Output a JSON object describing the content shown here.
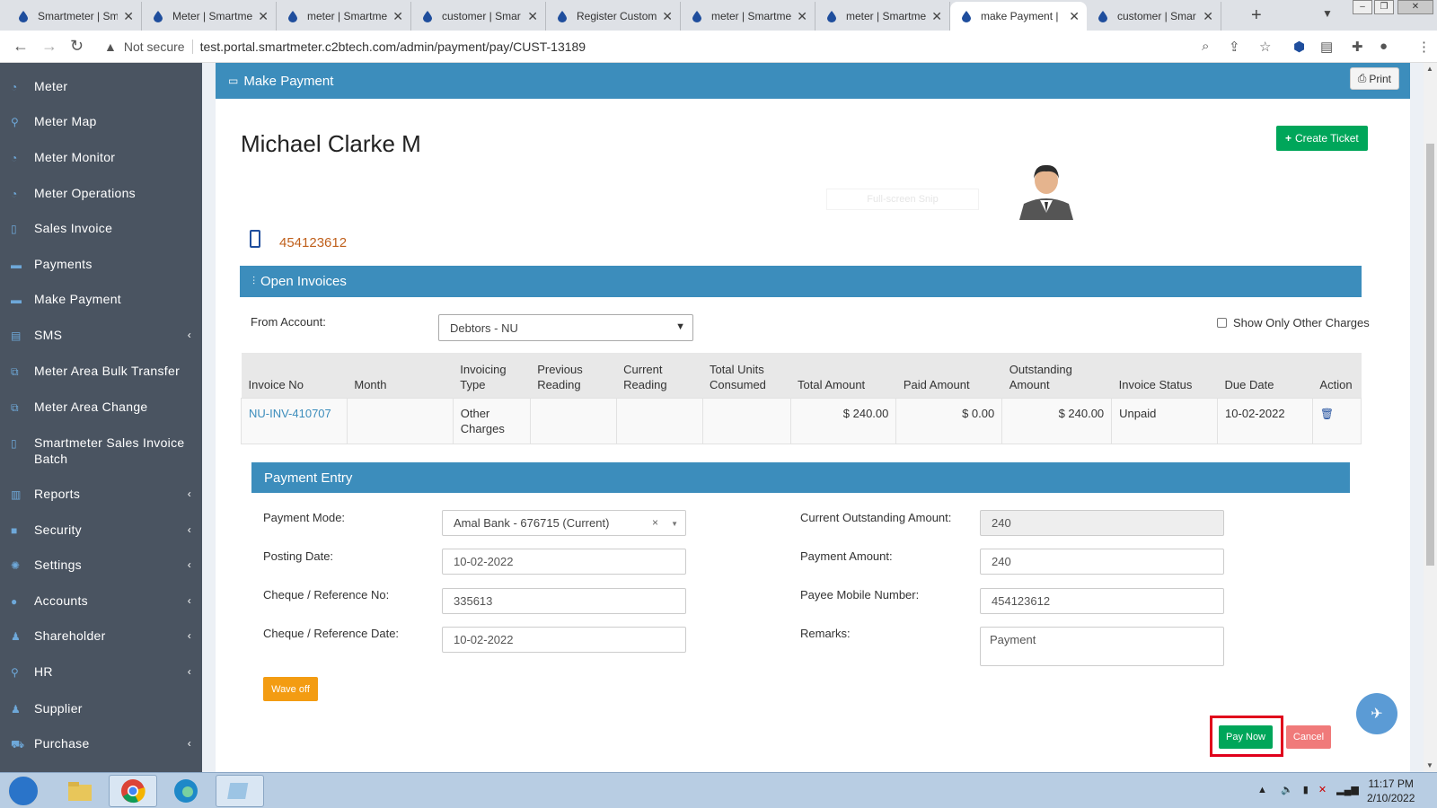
{
  "browser": {
    "tabs": [
      {
        "title": "Smartmeter | Sm"
      },
      {
        "title": "Meter | Smartme"
      },
      {
        "title": "meter | Smartme"
      },
      {
        "title": "customer | Smar"
      },
      {
        "title": "Register Custom"
      },
      {
        "title": "meter | Smartme"
      },
      {
        "title": "meter | Smartme"
      },
      {
        "title": "make Payment |"
      },
      {
        "title": "customer | Smar"
      }
    ],
    "not_secure": "Not secure",
    "url": "test.portal.smartmeter.c2btech.com/admin/payment/pay/CUST-13189"
  },
  "sidebar": {
    "items": [
      {
        "label": "Meter",
        "icon": "dashboard-icon"
      },
      {
        "label": "Meter Map",
        "icon": "map-pin-icon"
      },
      {
        "label": "Meter Monitor",
        "icon": "dashboard-icon"
      },
      {
        "label": "Meter Operations",
        "icon": "dashboard-icon"
      },
      {
        "label": "Sales Invoice",
        "icon": "file-icon"
      },
      {
        "label": "Payments",
        "icon": "credit-card-icon"
      },
      {
        "label": "Make Payment",
        "icon": "credit-card-icon"
      },
      {
        "label": "SMS",
        "icon": "sms-icon",
        "chevron": true
      },
      {
        "label": "Meter Area Bulk Transfer",
        "icon": "external-icon"
      },
      {
        "label": "Meter Area Change",
        "icon": "external-icon"
      },
      {
        "label": "Smartmeter Sales Invoice Batch",
        "icon": "file-icon"
      },
      {
        "label": "Reports",
        "icon": "book-icon",
        "chevron": true
      },
      {
        "label": "Security",
        "icon": "lock-icon",
        "chevron": true
      },
      {
        "label": "Settings",
        "icon": "gear-icon",
        "chevron": true
      },
      {
        "label": "Accounts",
        "icon": "globe-icon",
        "chevron": true
      },
      {
        "label": "Shareholder",
        "icon": "user-icon",
        "chevron": true
      },
      {
        "label": "HR",
        "icon": "badge-icon",
        "chevron": true
      },
      {
        "label": "Supplier",
        "icon": "user-icon"
      },
      {
        "label": "Purchase",
        "icon": "cart-icon",
        "chevron": true
      }
    ]
  },
  "header": {
    "title": "Make Payment",
    "print_label": "Print"
  },
  "customer": {
    "name": "Michael Clarke M",
    "create_ticket_label": "Create Ticket",
    "snip_label": "Full-screen Snip",
    "phone": "454123612"
  },
  "open_invoices": {
    "title": "Open Invoices",
    "from_account_label": "From Account:",
    "from_account_value": "Debtors - NU",
    "show_only_label": "Show Only Other Charges",
    "columns": [
      "Invoice No",
      "Month",
      "Invoicing Type",
      "Previous Reading",
      "Current Reading",
      "Total Units Consumed",
      "Total Amount",
      "Paid Amount",
      "Outstanding Amount",
      "Invoice Status",
      "Due Date",
      "Action"
    ],
    "rows": [
      {
        "invoice_no": "NU-INV-410707",
        "month": "",
        "type": "Other Charges",
        "prev": "",
        "curr": "",
        "units": "",
        "total": "$ 240.00",
        "paid": "$ 0.00",
        "outstanding": "$ 240.00",
        "status": "Unpaid",
        "due": "10-02-2022"
      }
    ]
  },
  "payment_entry": {
    "title": "Payment Entry",
    "payment_mode_label": "Payment Mode:",
    "payment_mode_value": "Amal Bank - 676715 (Current)",
    "posting_date_label": "Posting Date:",
    "posting_date_value": "10-02-2022",
    "ref_no_label": "Cheque / Reference No:",
    "ref_no_value": "335613",
    "ref_date_label": "Cheque / Reference Date:",
    "ref_date_value": "10-02-2022",
    "outstanding_label": "Current Outstanding Amount:",
    "outstanding_value": "240",
    "amount_label": "Payment Amount:",
    "amount_value": "240",
    "mobile_label": "Payee Mobile Number:",
    "mobile_value": "454123612",
    "remarks_label": "Remarks:",
    "remarks_value": "Payment",
    "wave_off_label": "Wave off",
    "pay_now_label": "Pay Now",
    "cancel_label": "Cancel"
  },
  "taskbar": {
    "time": "11:17 PM",
    "date": "2/10/2022"
  },
  "colors": {
    "primary": "#3c8dbc",
    "sidebar": "#4a5461",
    "success": "#00a65a",
    "warning": "#f39c12",
    "danger": "#dd4b39",
    "highlight": "#e0001b"
  }
}
